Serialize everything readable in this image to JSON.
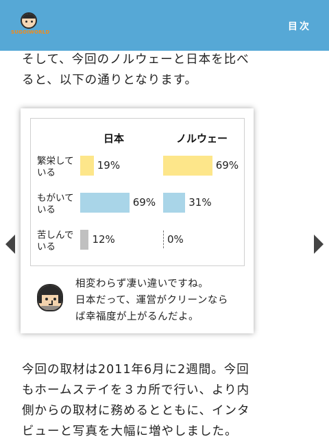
{
  "header": {
    "logo_text": "SUGOIWORLD",
    "toc_label": "目次",
    "background": "#56a8d6"
  },
  "intro": {
    "lines": [
      "そして、今回のノルウェーと日本を比べ",
      "ると、以下の通りとなります。"
    ]
  },
  "comparison": {
    "columns": [
      "日本",
      "ノルウェー"
    ],
    "rows": [
      {
        "label_lines": [
          "繁栄して",
          "いる"
        ],
        "japan": "19%",
        "norway": "69%",
        "japan_value": 19,
        "norway_value": 69,
        "color": "#fde68a"
      },
      {
        "label_lines": [
          "もがいて",
          "いる"
        ],
        "japan": "69%",
        "norway": "31%",
        "japan_value": 69,
        "norway_value": 31,
        "color": "#a9d5e8"
      },
      {
        "label_lines": [
          "苦しんで",
          "いる"
        ],
        "japan": "12%",
        "norway": "0%",
        "japan_value": 12,
        "norway_value": 0,
        "color": "#c0c0c0"
      }
    ]
  },
  "comment": {
    "lines": [
      "相変わらず凄い違いですね。",
      "日本だって、運営がクリーンなら",
      "ば幸福度が上がるんだよ。"
    ]
  },
  "body": {
    "lines": [
      "今回の取材は2011年6月に2週間。今回",
      "もホームステイを３カ所で行い、より内",
      "側からの取材に務めるとともに、インタ",
      "ビューと写真を大幅に増やしました。"
    ]
  },
  "nav": {
    "prev_icon": "triangle-left-icon",
    "next_icon": "triangle-right-icon"
  }
}
